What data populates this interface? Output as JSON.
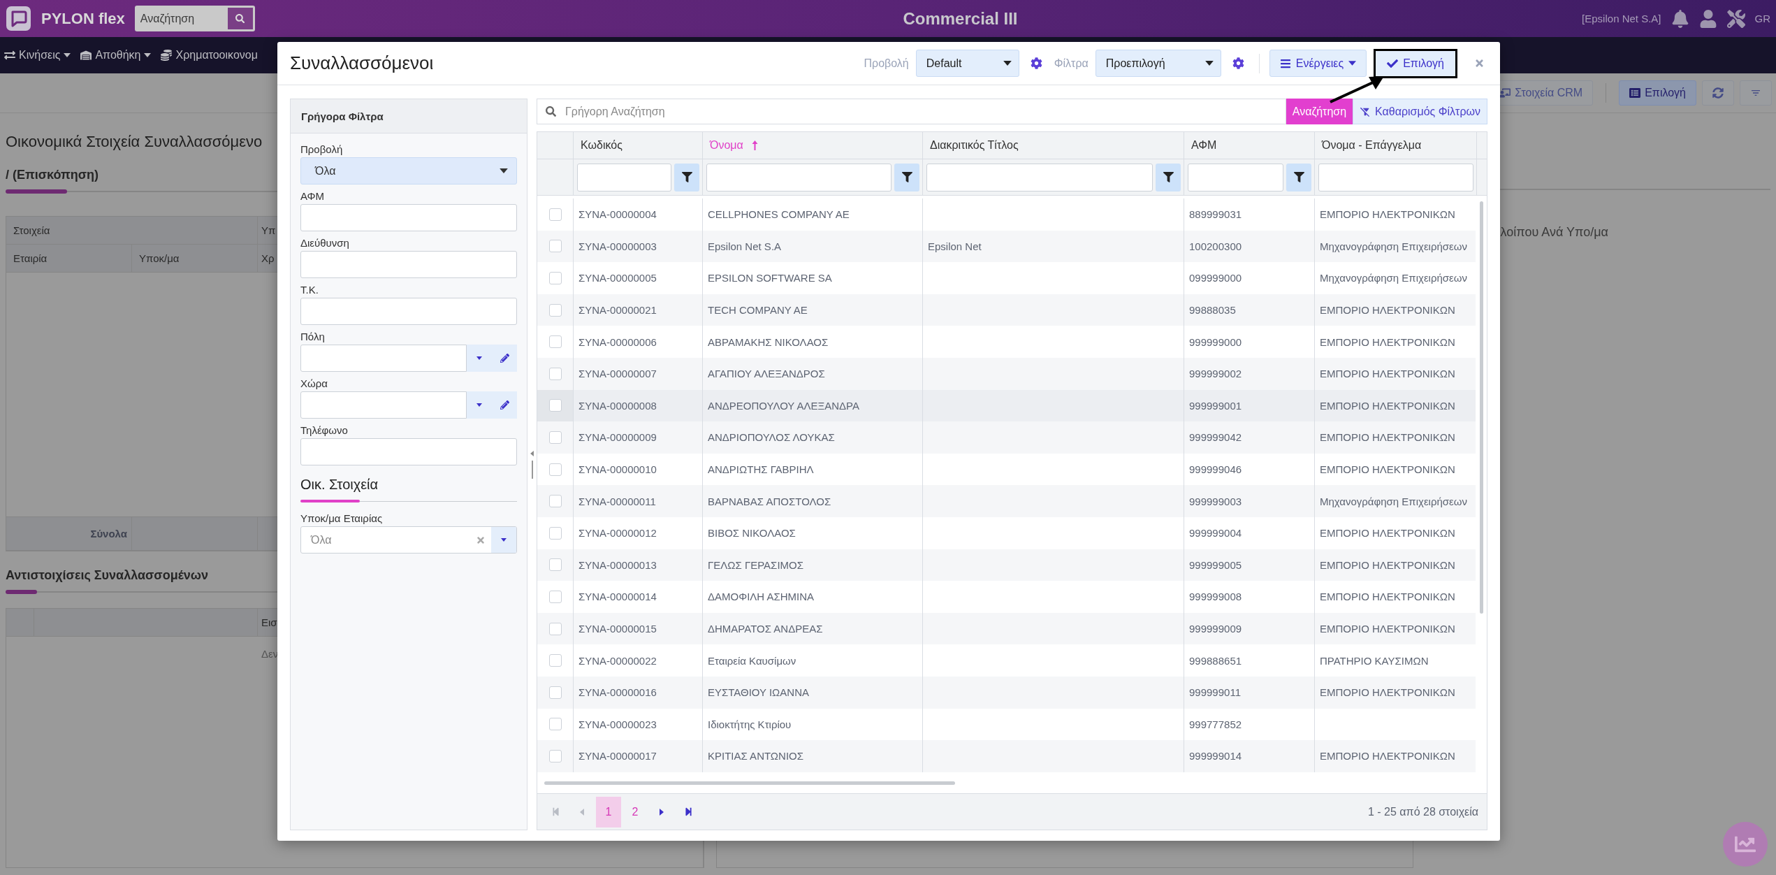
{
  "top_bar": {
    "app_name": "PYLON flex",
    "search": {
      "placeholder": "Αναζήτηση"
    },
    "title": "Commercial III",
    "company": "[Epsilon Net S.A]",
    "language": "GR"
  },
  "menu_bar": [
    {
      "label": "Κινήσεις",
      "caret": true
    },
    {
      "label": "Αποθήκη",
      "caret": true
    },
    {
      "label": "Χρηματοοικονομ",
      "caret": false
    }
  ],
  "toolbar": {
    "crm_button": "Στοιχεία CRM",
    "select_button": "Επιλογή"
  },
  "page": {
    "title": "Οικονομικά Στοιχεία Συναλλασσόμενο",
    "section": "/ (Επισκόπηση)",
    "summary_table": {
      "group_headers": [
        "Στοιχεία",
        "Υπ"
      ],
      "columns": [
        "Εταιρία",
        "Υποκ/μα",
        "Χρ"
      ],
      "totals_label": "Σύνολα"
    },
    "matches_title": "Αντιστοιχίσεις Συναλλασσομένων",
    "matches_table": {
      "column_3": "Εισ",
      "empty_message": "Δεν"
    },
    "right_panel_title": "λοίπου Ανά Υπο/μα"
  },
  "modal": {
    "title": "Συναλλασσόμενοι",
    "view_label": "Προβολή",
    "view_value": "Default",
    "filters_label": "Φίλτρα",
    "filters_value": "Προεπιλογή",
    "actions_button": "Ενέργειες",
    "select_button": {
      "label": "Επιλογή",
      "highlighted": true
    }
  },
  "quick_filters": {
    "title": "Γρήγορα Φίλτρα",
    "fields": [
      {
        "kind": "select",
        "label": "Προβολή",
        "value": "Όλα"
      },
      {
        "kind": "text",
        "label": "ΑΦΜ"
      },
      {
        "kind": "text",
        "label": "Διεύθυνση"
      },
      {
        "kind": "text",
        "label": "Τ.Κ."
      },
      {
        "kind": "lookup",
        "label": "Πόλη"
      },
      {
        "kind": "lookup",
        "label": "Χώρα"
      },
      {
        "kind": "text",
        "label": "Τηλέφωνο"
      }
    ],
    "section": "Οικ. Στοιχεία",
    "company_field": {
      "label": "Υποκ/μα Εταιρίας",
      "value": "Όλα"
    }
  },
  "grid": {
    "search": {
      "placeholder": "Γρήγορη Αναζήτηση",
      "button": "Αναζήτηση"
    },
    "clear_filters": "Καθαρισμός Φίλτρων",
    "columns": [
      {
        "label": "Κωδικός",
        "sorted": false,
        "filter_button": true
      },
      {
        "label": "Όνομα",
        "sorted": true,
        "filter_button": true
      },
      {
        "label": "Διακριτικός Τίτλος",
        "sorted": false,
        "filter_button": true
      },
      {
        "label": "ΑΦΜ",
        "sorted": false,
        "filter_button": true
      },
      {
        "label": "Όνομα - Επάγγελμα",
        "sorted": false,
        "filter_button": false
      }
    ],
    "rows": [
      {
        "code": "ΣΥΝΑ-00000004",
        "name": "CELLPHONES COMPANY AE",
        "afm": "889999031",
        "profession": "ΕΜΠΟΡΙΟ ΗΛΕΚΤΡΟΝΙΚΩΝ",
        "checked": false,
        "hovered": false
      },
      {
        "code": "ΣΥΝΑ-00000003",
        "name": "Epsilon Net S.A",
        "title": "Epsilon Net",
        "afm": "100200300",
        "profession": "Μηχανογράφηση Επιχειρήσεων",
        "checked": false,
        "hovered": false
      },
      {
        "code": "ΣΥΝΑ-00000005",
        "name": "EPSILON SOFTWARE SA",
        "afm": "099999000",
        "profession": "Μηχανογράφηση Επιχειρήσεων",
        "checked": false,
        "hovered": false
      },
      {
        "code": "ΣΥΝΑ-00000021",
        "name": "TECH COMPANY AE",
        "afm": "99888035",
        "profession": "ΕΜΠΟΡΙΟ ΗΛΕΚΤΡΟΝΙΚΩΝ",
        "checked": false,
        "hovered": false
      },
      {
        "code": "ΣΥΝΑ-00000006",
        "name": "ΑΒΡΑΜΑΚΗΣ ΝΙΚΟΛΑΟΣ",
        "afm": "999999000",
        "profession": "ΕΜΠΟΡΙΟ ΗΛΕΚΤΡΟΝΙΚΩΝ",
        "checked": false,
        "hovered": false
      },
      {
        "code": "ΣΥΝΑ-00000007",
        "name": "ΑΓΑΠΙΟΥ ΑΛΕΞΑΝΔΡΟΣ",
        "afm": "999999002",
        "profession": "ΕΜΠΟΡΙΟ ΗΛΕΚΤΡΟΝΙΚΩΝ",
        "checked": false,
        "hovered": false
      },
      {
        "code": "ΣΥΝΑ-00000008",
        "name": "ΑΝΔΡΕΟΠΟΥΛΟΥ ΑΛΕΞΑΝΔΡΑ",
        "afm": "999999001",
        "profession": "ΕΜΠΟΡΙΟ ΗΛΕΚΤΡΟΝΙΚΩΝ",
        "checked": false,
        "hovered": true
      },
      {
        "code": "ΣΥΝΑ-00000009",
        "name": "ΑΝΔΡΙΟΠΟΥΛΟΣ ΛΟΥΚΑΣ",
        "afm": "999999042",
        "profession": "ΕΜΠΟΡΙΟ ΗΛΕΚΤΡΟΝΙΚΩΝ",
        "checked": false,
        "hovered": false
      },
      {
        "code": "ΣΥΝΑ-00000010",
        "name": "ΑΝΔΡΙΩΤΗΣ ΓΑΒΡΙΗΛ",
        "afm": "999999046",
        "profession": "ΕΜΠΟΡΙΟ ΗΛΕΚΤΡΟΝΙΚΩΝ",
        "checked": false,
        "hovered": false
      },
      {
        "code": "ΣΥΝΑ-00000011",
        "name": "ΒΑΡΝΑΒΑΣ ΑΠΟΣΤΟΛΟΣ",
        "afm": "999999003",
        "profession": "Μηχανογράφηση Επιχειρήσεων",
        "checked": false,
        "hovered": false
      },
      {
        "code": "ΣΥΝΑ-00000012",
        "name": "ΒΙΒΟΣ ΝΙΚΟΛΑΟΣ",
        "afm": "999999004",
        "profession": "ΕΜΠΟΡΙΟ ΗΛΕΚΤΡΟΝΙΚΩΝ",
        "checked": false,
        "hovered": false
      },
      {
        "code": "ΣΥΝΑ-00000013",
        "name": "ΓΕΛΩΣ ΓΕΡΑΣΙΜΟΣ",
        "afm": "999999005",
        "profession": "ΕΜΠΟΡΙΟ ΗΛΕΚΤΡΟΝΙΚΩΝ",
        "checked": false,
        "hovered": false
      },
      {
        "code": "ΣΥΝΑ-00000014",
        "name": "ΔΑΜΟΦΙΛΗ ΑΣΗΜΙΝΑ",
        "afm": "999999008",
        "profession": "ΕΜΠΟΡΙΟ ΗΛΕΚΤΡΟΝΙΚΩΝ",
        "checked": false,
        "hovered": false
      },
      {
        "code": "ΣΥΝΑ-00000015",
        "name": "ΔΗΜΑΡΑΤΟΣ ΑΝΔΡΕΑΣ",
        "afm": "999999009",
        "profession": "ΕΜΠΟΡΙΟ ΗΛΕΚΤΡΟΝΙΚΩΝ",
        "checked": false,
        "hovered": false
      },
      {
        "code": "ΣΥΝΑ-00000022",
        "name": "Εταιρεία Καυσίμων",
        "afm": "999888651",
        "profession": "ΠΡΑΤΗΡΙΟ ΚΑΥΣΙΜΩΝ",
        "checked": false,
        "hovered": false
      },
      {
        "code": "ΣΥΝΑ-00000016",
        "name": "ΕΥΣΤΑΘΙΟΥ ΙΩΑΝΝΑ",
        "afm": "999999011",
        "profession": "ΕΜΠΟΡΙΟ ΗΛΕΚΤΡΟΝΙΚΩΝ",
        "checked": false,
        "hovered": false
      },
      {
        "code": "ΣΥΝΑ-00000023",
        "name": "Ιδιοκτήτης Κτιρίου",
        "afm": "999777852",
        "checked": false,
        "hovered": false
      },
      {
        "code": "ΣΥΝΑ-00000017",
        "name": "ΚΡΙΤΙΑΣ ΑΝΤΩΝΙΟΣ",
        "afm": "999999014",
        "profession": "ΕΜΠΟΡΙΟ ΗΛΕΚΤΡΟΝΙΚΩΝ",
        "checked": false,
        "hovered": false
      }
    ],
    "pager": {
      "pages": [
        {
          "label": "1",
          "selected": true
        },
        {
          "label": "2",
          "selected": false
        }
      ],
      "summary": "1 - 25 από 28 στοιχεία"
    }
  }
}
